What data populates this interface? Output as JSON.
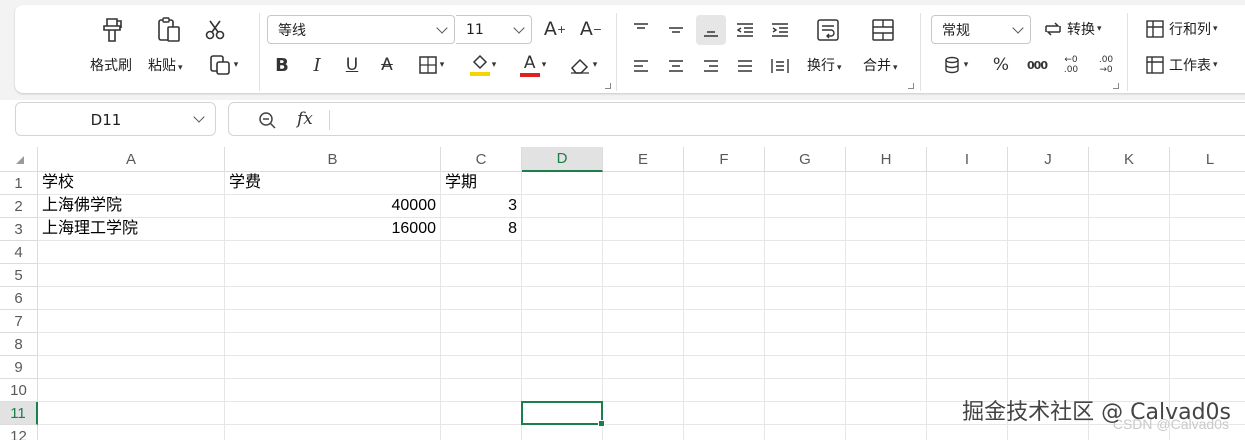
{
  "ribbon": {
    "clipboard": {
      "format_painter": "格式刷",
      "paste": "粘贴"
    },
    "font": {
      "name": "等线",
      "size": "11",
      "bold": "B",
      "italic": "I",
      "underline": "U",
      "font_color_letter": "A",
      "fill_color": "#f5d300",
      "font_color": "#e02020"
    },
    "alignment": {
      "wrap": "换行",
      "merge": "合并"
    },
    "number": {
      "format": "常规",
      "convert": "转换",
      "percent": "%",
      "thousands": "000",
      "inc_decimal": "←0 .00",
      "dec_decimal": ".00 →0"
    },
    "cells": {
      "rows_cols": "行和列",
      "worksheet": "工作表"
    }
  },
  "formula_bar": {
    "name_box": "D11",
    "fx": "fx",
    "formula": ""
  },
  "sheet": {
    "columns": [
      "A",
      "B",
      "C",
      "D",
      "E",
      "F",
      "G",
      "H",
      "I",
      "J",
      "K",
      "L"
    ],
    "selected_column": "D",
    "rows": [
      "1",
      "2",
      "3",
      "4",
      "5",
      "6",
      "7",
      "8",
      "9",
      "10",
      "11",
      "12"
    ],
    "selected_row": "11",
    "cells": {
      "A1": "学校",
      "B1": "学费",
      "C1": "学期",
      "A2": "上海佛学院",
      "B2": "40000",
      "C2": "3",
      "A3": "上海理工学院",
      "B3": "16000",
      "C3": "8"
    },
    "active_cell": "D11",
    "accent_color": "#1a7f4b"
  },
  "watermark": {
    "main": "掘金技术社区 @ Calvad0s",
    "sub": "CSDN @Calvad0s"
  }
}
